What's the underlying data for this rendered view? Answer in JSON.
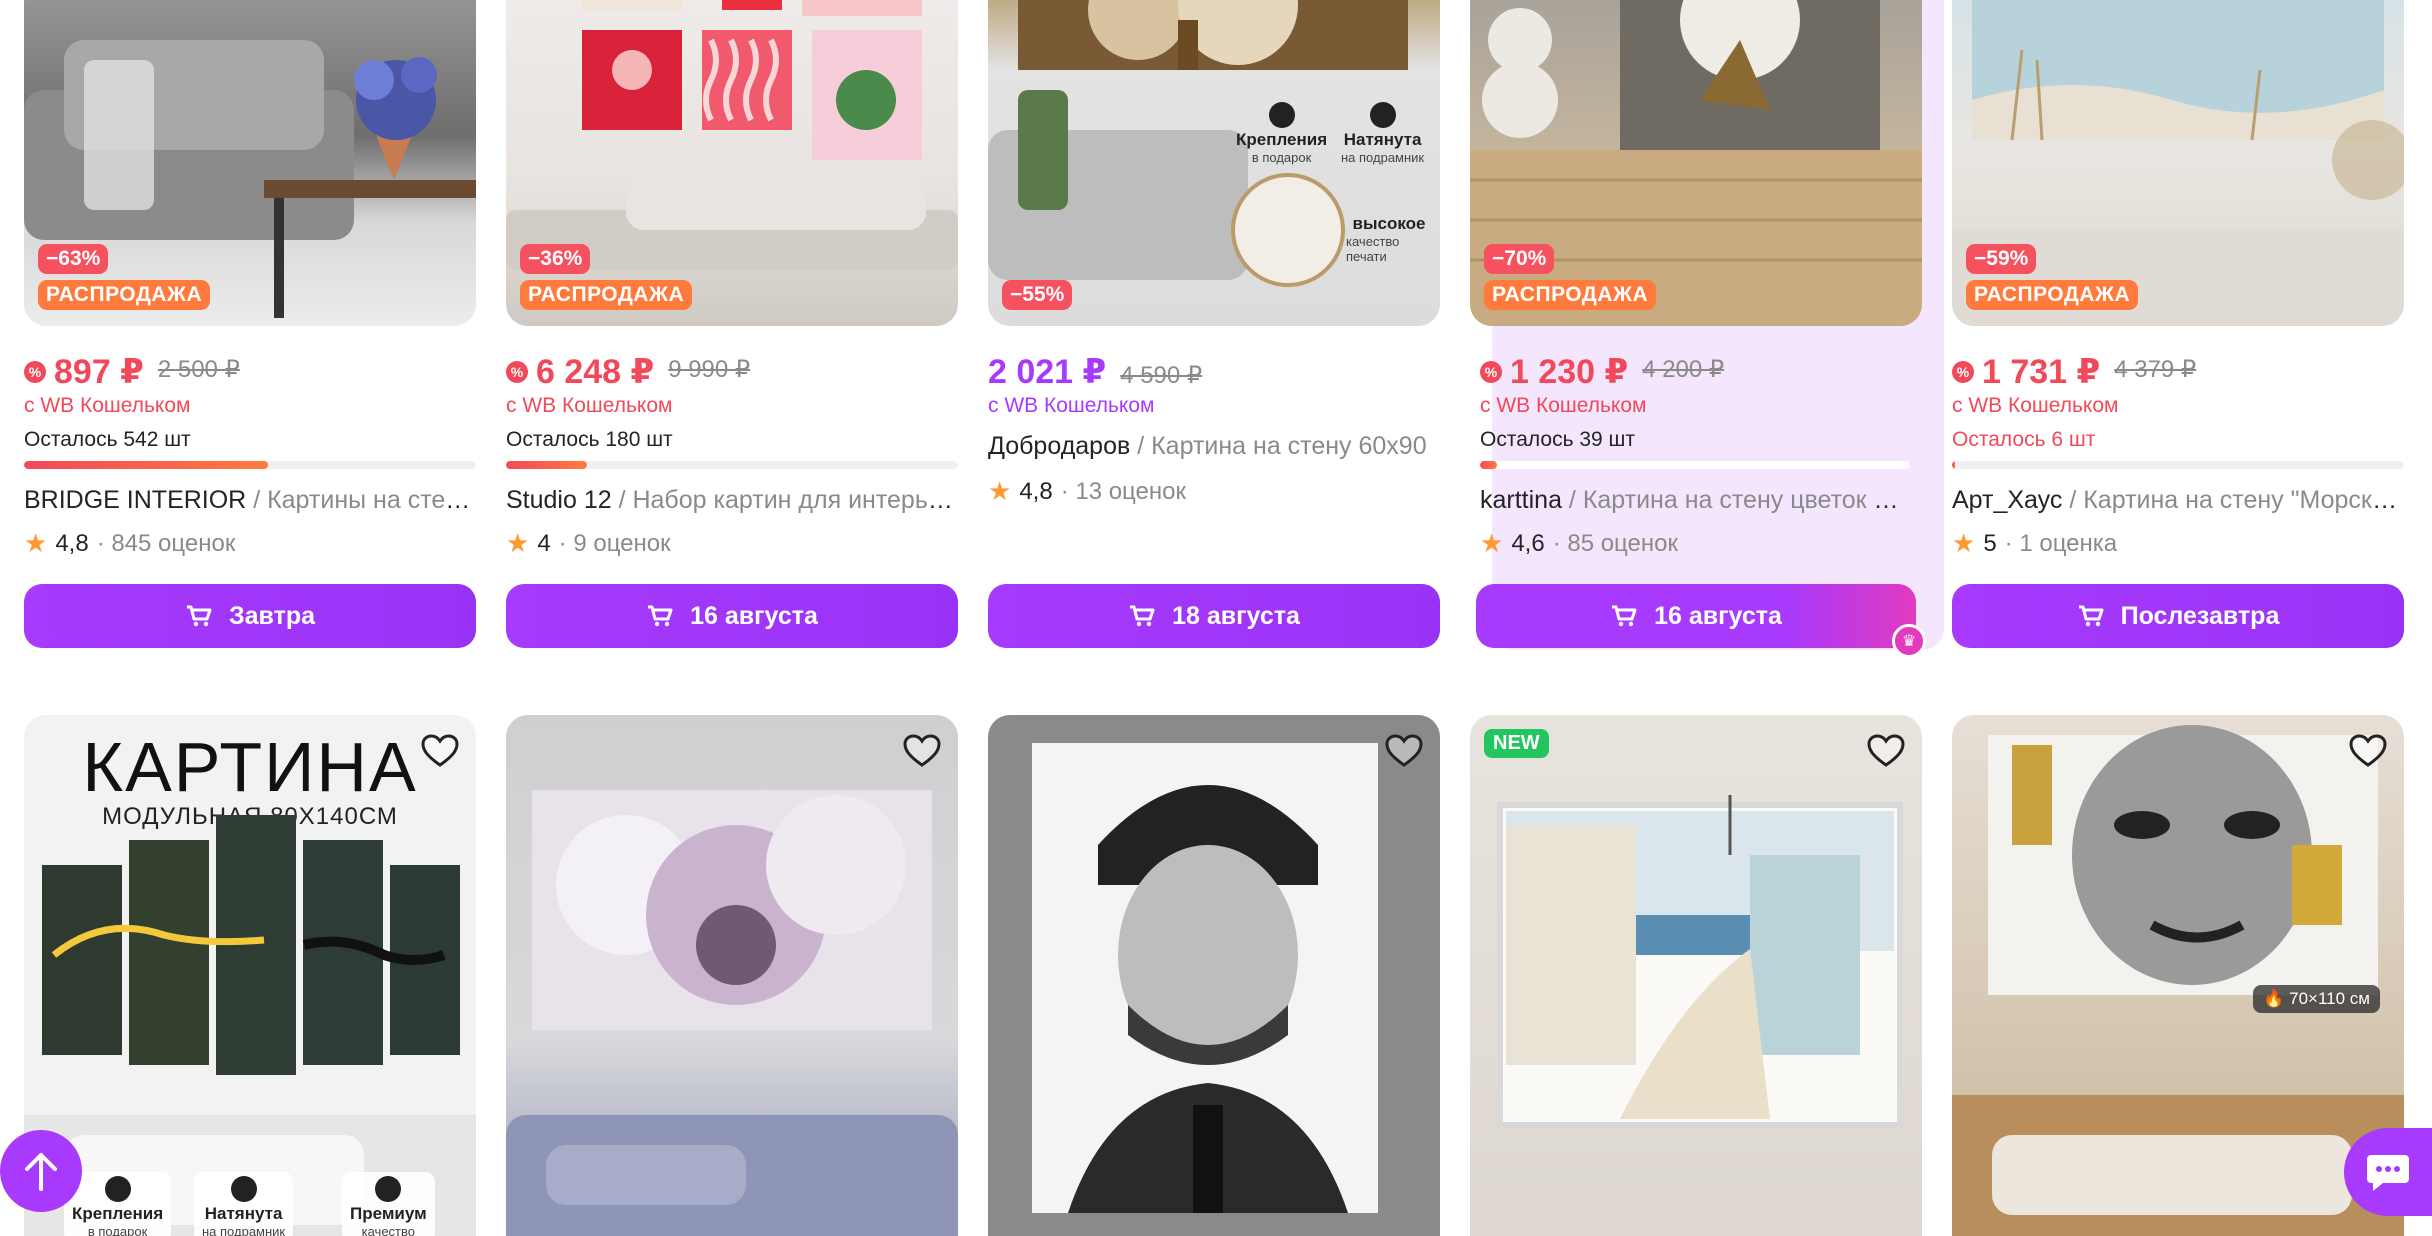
{
  "colors": {
    "accent": "#a73afd",
    "price_red": "#f2495a",
    "sale_orange": "#ff7a3d",
    "new_green": "#22c55e"
  },
  "row1": [
    {
      "discount": "−63%",
      "sale": "РАСПРОДАЖА",
      "price": "897 ₽",
      "old_price": "2 500 ₽",
      "wallet": "с WB Кошельком",
      "stock": "Осталось 542 шт",
      "stock_level": 0.54,
      "brand": "BRIDGE INTERIOR",
      "desc": " / Картины на стену интерьерные",
      "rating": "4,8",
      "reviews": "· 845 оценок",
      "delivery": "Завтра"
    },
    {
      "discount": "−36%",
      "sale": "РАСПРОДАЖА",
      "price": "6 248 ₽",
      "old_price": "9 990 ₽",
      "wallet": "с WB Кошельком",
      "stock": "Осталось 180 шт",
      "stock_level": 0.18,
      "brand": "Studio 12",
      "desc": " / Набор картин для интерьера",
      "rating": "4",
      "reviews": "· 9 оценок",
      "delivery": "16 августа"
    },
    {
      "discount": "−55%",
      "price": "2 021 ₽",
      "old_price": "4 590 ₽",
      "wallet": "с WB Кошельком",
      "brand": "Добродаров",
      "desc": " / Картина на стену 60х90",
      "rating": "4,8",
      "reviews": "· 13 оценок",
      "delivery": "18 августа",
      "img_text": {
        "f1": "Крепления",
        "f1s": "в подарок",
        "f2": "Натянута",
        "f2s": "на подрамник",
        "f3": "высокое",
        "f3s": "качество печати"
      }
    },
    {
      "discount": "−70%",
      "sale": "РАСПРОДАЖА",
      "price": "1 230 ₽",
      "old_price": "4 200 ₽",
      "wallet": "с WB Кошельком",
      "stock": "Осталось 39 шт",
      "stock_level": 0.04,
      "brand": "karttina",
      "desc": " / Картина на стену цветок на холсте",
      "rating": "4,6",
      "reviews": "· 85 оценок",
      "delivery": "16 августа"
    },
    {
      "discount": "−59%",
      "sale": "РАСПРОДАЖА",
      "price": "1 731 ₽",
      "old_price": "4 379 ₽",
      "wallet": "с WB Кошельком",
      "stock": "Осталось 6 шт",
      "stock_level": 0.005,
      "brand": "Арт_Хаус",
      "desc": " / Картина на стену \"Морской берег\"",
      "rating": "5",
      "reviews": "· 1 оценка",
      "delivery": "Послезавтра"
    }
  ],
  "row2": {
    "card1": {
      "headline": "КАРТИНА",
      "subline": "МОДУЛЬНАЯ 80Х140СМ",
      "f1": "Крепления",
      "f1s": "в подарок",
      "f2": "Натянута",
      "f2s": "на подрамник",
      "f3": "Премиум",
      "f3s": "качество"
    },
    "card4": {
      "new": "NEW"
    },
    "card5": {
      "size": "70×110 см"
    }
  },
  "icons": {
    "heart": "heart-icon",
    "cart": "cart-icon",
    "up": "arrow-up-icon",
    "chat": "chat-icon",
    "star": "star-icon"
  }
}
